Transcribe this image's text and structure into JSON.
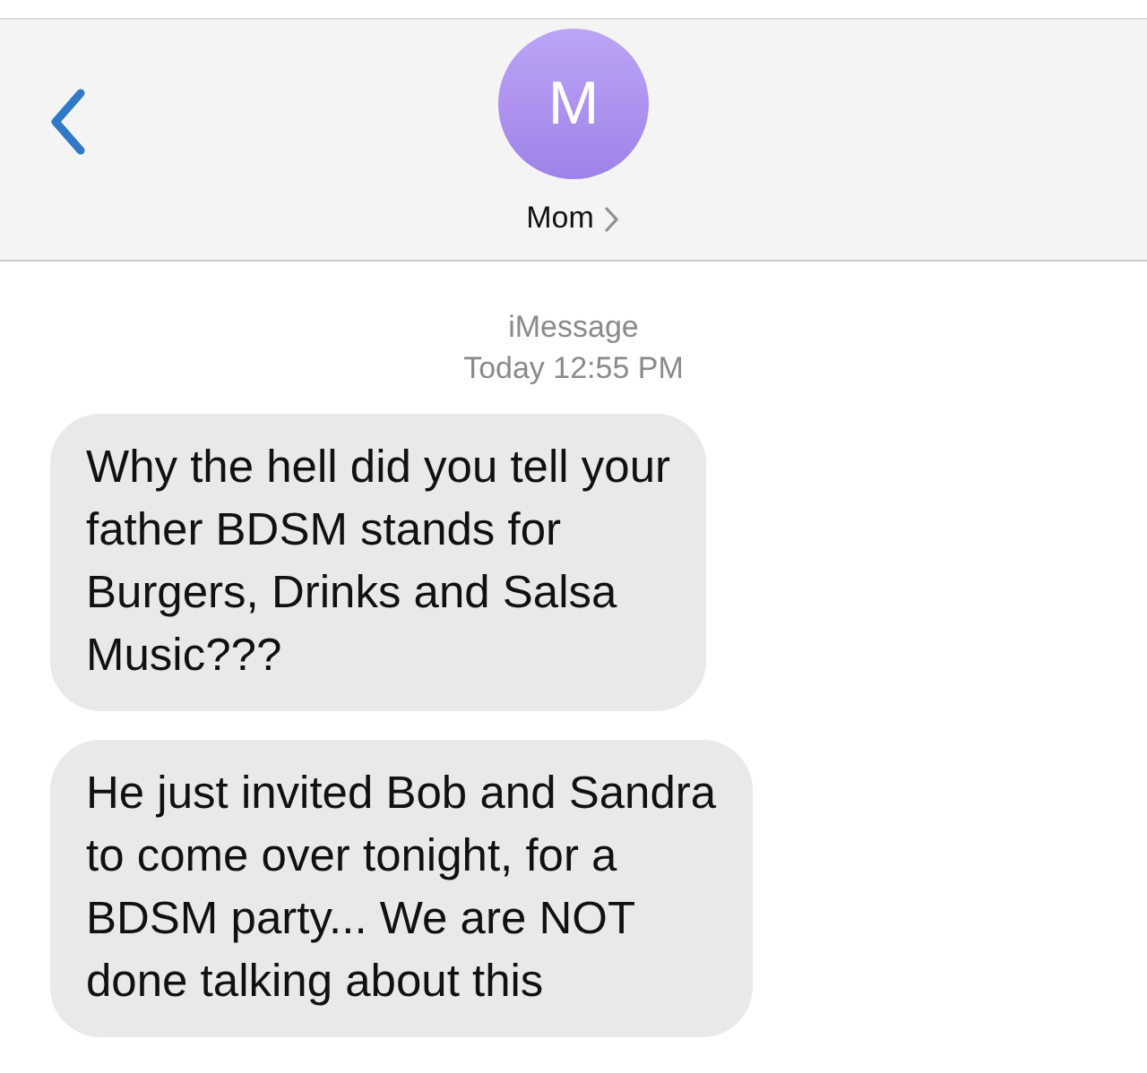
{
  "header": {
    "avatar_initial": "M",
    "contact_name": "Mom"
  },
  "conversation": {
    "service": "iMessage",
    "timestamp": "Today 12:55 PM"
  },
  "messages": [
    {
      "text": "Why the hell did you tell your\nfather BDSM stands for\nBurgers, Drinks and Salsa\nMusic???"
    },
    {
      "text": "He just invited Bob and Sandra\nto come over tonight, for a\nBDSM party... We are NOT\ndone talking about this"
    }
  ]
}
